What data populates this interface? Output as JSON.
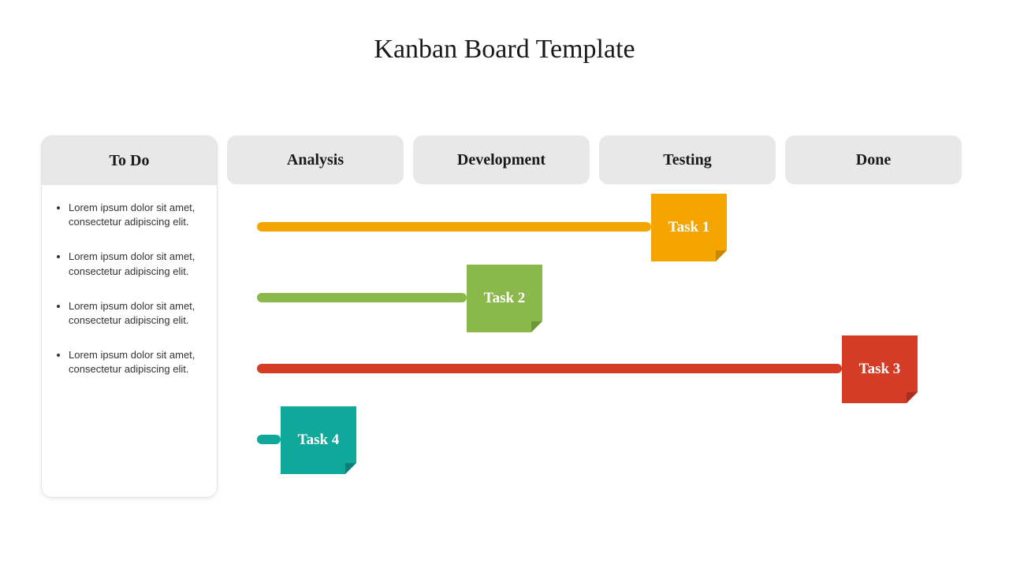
{
  "title": "Kanban Board Template",
  "columns": {
    "todo": "To Do",
    "analysis": "Analysis",
    "development": "Development",
    "testing": "Testing",
    "done": "Done"
  },
  "todo_items": [
    "Lorem ipsum dolor sit amet, consectetur adipiscing elit.",
    "Lorem ipsum dolor sit amet, consectetur adipiscing elit.",
    "Lorem ipsum dolor sit amet, consectetur adipiscing elit.",
    "Lorem ipsum dolor sit amet, consectetur adipiscing elit."
  ],
  "tasks": [
    {
      "label": "Task 1",
      "color": "#f5a500"
    },
    {
      "label": "Task 2",
      "color": "#8bb84a"
    },
    {
      "label": "Task 3",
      "color": "#d43c26"
    },
    {
      "label": "Task 4",
      "color": "#0fa89a"
    }
  ]
}
